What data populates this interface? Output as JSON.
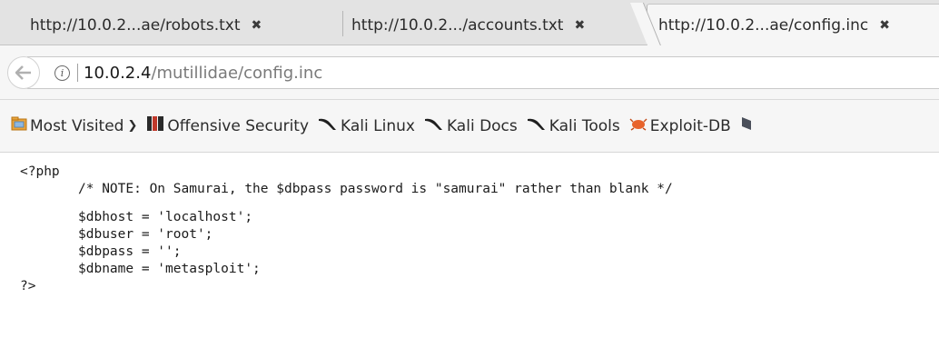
{
  "tabs": [
    {
      "title": "http://10.0.2...ae/robots.txt",
      "close": "✖"
    },
    {
      "title": "http://10.0.2.../accounts.txt",
      "close": "✖"
    },
    {
      "title": "http://10.0.2...ae/config.inc",
      "close": "✖",
      "active": true
    }
  ],
  "navbar": {
    "back_icon": "back-arrow-icon",
    "info_icon": "info-icon",
    "url_host": "10.0.2.4",
    "url_path": "/mutillidae/config.inc"
  },
  "bookmarks": [
    {
      "label": "Most Visited",
      "icon": "folder-icon",
      "chevron": "⌵"
    },
    {
      "label": "Offensive Security",
      "icon": "offsec-icon"
    },
    {
      "label": "Kali Linux",
      "icon": "kali-dragon-icon"
    },
    {
      "label": "Kali Docs",
      "icon": "kali-dragon-icon"
    },
    {
      "label": "Kali Tools",
      "icon": "kali-dragon-icon"
    },
    {
      "label": "Exploit-DB",
      "icon": "exploitdb-icon"
    }
  ],
  "content": {
    "lines": [
      "<?php",
      "/* NOTE: On Samurai, the $dbpass password is \"samurai\" rather than blank */",
      "$dbhost = 'localhost';",
      "$dbuser = 'root';",
      "$dbpass = '';",
      "$dbname = 'metasploit';",
      "?>"
    ]
  }
}
